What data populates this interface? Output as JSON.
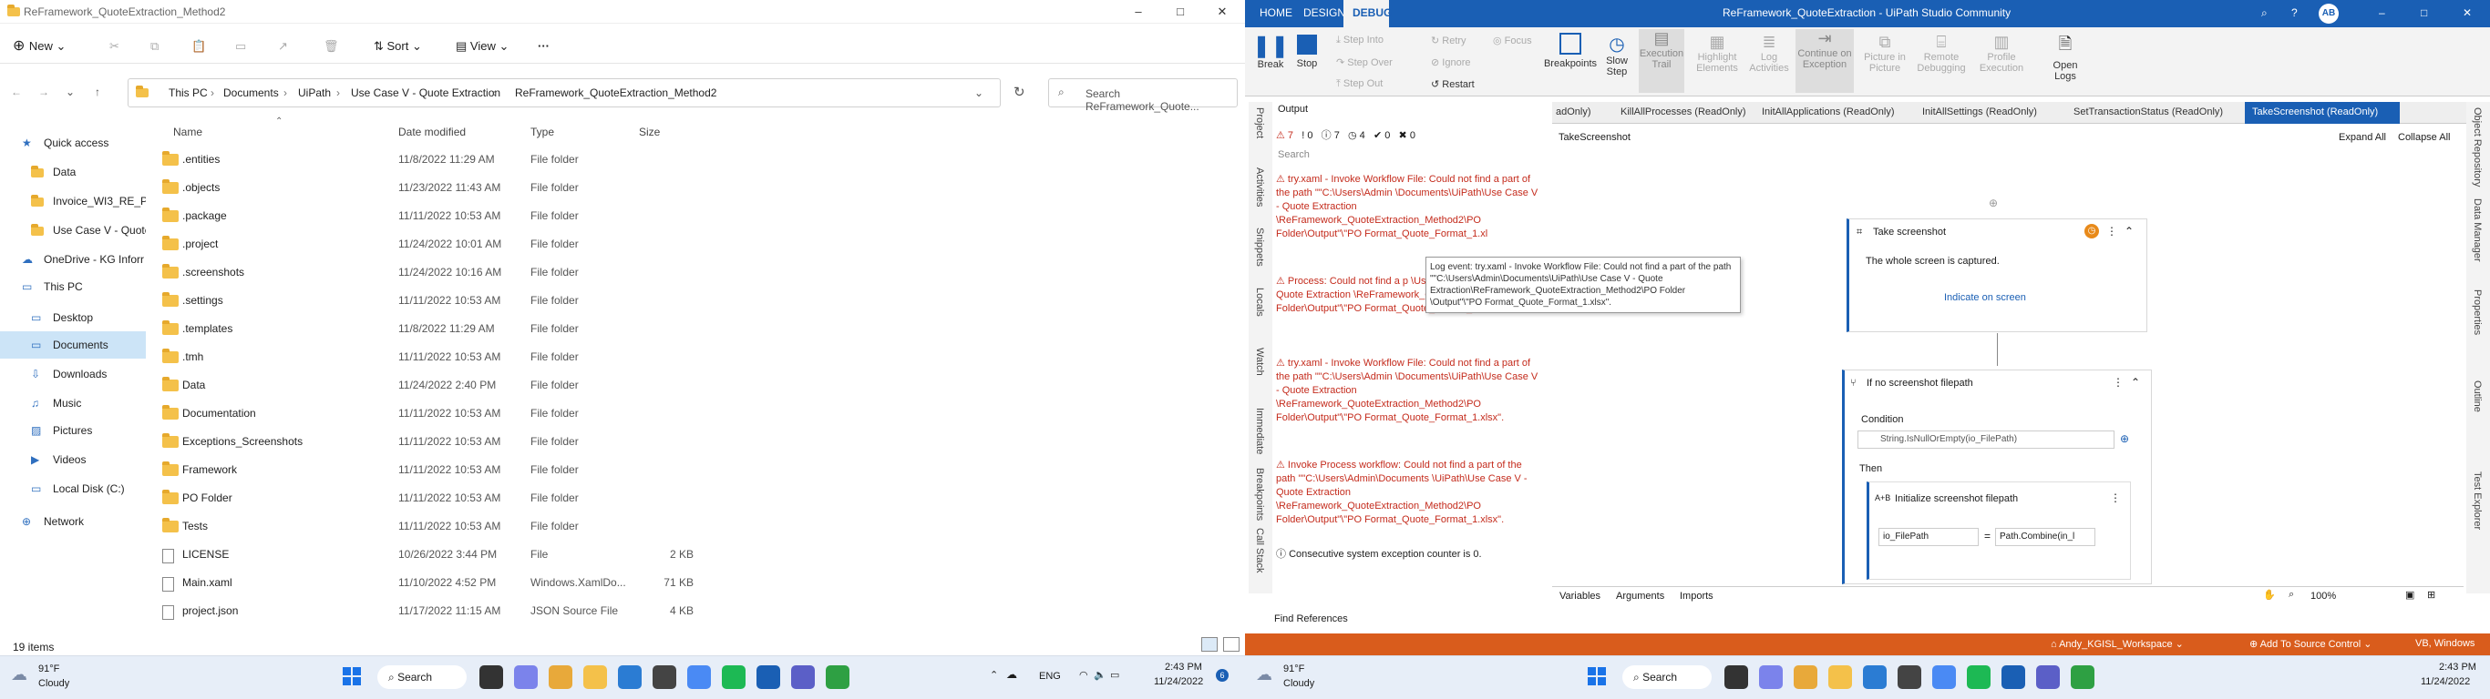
{
  "explorer": {
    "title": "ReFramework_QuoteExtraction_Method2",
    "cmd": {
      "new": "New",
      "sort": "Sort",
      "view": "View",
      "more": "···"
    },
    "breadcrumb": [
      "This PC",
      "Documents",
      "UiPath",
      "Use Case V - Quote Extraction",
      "ReFramework_QuoteExtraction_Method2"
    ],
    "search_placeholder": "Search ReFramework_Quote...",
    "nav": [
      "Quick access",
      "Data",
      "Invoice_WI3_RE_Pe",
      "Use Case V - Quote",
      "OneDrive - KG Inforr",
      "This PC",
      "Desktop",
      "Documents",
      "Downloads",
      "Music",
      "Pictures",
      "Videos",
      "Local Disk (C:)",
      "Network"
    ],
    "columns": {
      "name": "Name",
      "date": "Date modified",
      "type": "Type",
      "size": "Size"
    },
    "rows": [
      {
        "name": ".entities",
        "date": "11/8/2022 11:29 AM",
        "type": "File folder",
        "size": "",
        "kind": "folder"
      },
      {
        "name": ".objects",
        "date": "11/23/2022 11:43 AM",
        "type": "File folder",
        "size": "",
        "kind": "folder"
      },
      {
        "name": ".package",
        "date": "11/11/2022 10:53 AM",
        "type": "File folder",
        "size": "",
        "kind": "folder"
      },
      {
        "name": ".project",
        "date": "11/24/2022 10:01 AM",
        "type": "File folder",
        "size": "",
        "kind": "folder"
      },
      {
        "name": ".screenshots",
        "date": "11/24/2022 10:16 AM",
        "type": "File folder",
        "size": "",
        "kind": "folder"
      },
      {
        "name": ".settings",
        "date": "11/11/2022 10:53 AM",
        "type": "File folder",
        "size": "",
        "kind": "folder"
      },
      {
        "name": ".templates",
        "date": "11/8/2022 11:29 AM",
        "type": "File folder",
        "size": "",
        "kind": "folder"
      },
      {
        "name": ".tmh",
        "date": "11/11/2022 10:53 AM",
        "type": "File folder",
        "size": "",
        "kind": "folder"
      },
      {
        "name": "Data",
        "date": "11/24/2022 2:40 PM",
        "type": "File folder",
        "size": "",
        "kind": "folder"
      },
      {
        "name": "Documentation",
        "date": "11/11/2022 10:53 AM",
        "type": "File folder",
        "size": "",
        "kind": "folder"
      },
      {
        "name": "Exceptions_Screenshots",
        "date": "11/11/2022 10:53 AM",
        "type": "File folder",
        "size": "",
        "kind": "folder"
      },
      {
        "name": "Framework",
        "date": "11/11/2022 10:53 AM",
        "type": "File folder",
        "size": "",
        "kind": "folder"
      },
      {
        "name": "PO Folder",
        "date": "11/11/2022 10:53 AM",
        "type": "File folder",
        "size": "",
        "kind": "folder"
      },
      {
        "name": "Tests",
        "date": "11/11/2022 10:53 AM",
        "type": "File folder",
        "size": "",
        "kind": "folder"
      },
      {
        "name": "LICENSE",
        "date": "10/26/2022 3:44 PM",
        "type": "File",
        "size": "2 KB",
        "kind": "file"
      },
      {
        "name": "Main.xaml",
        "date": "11/10/2022 4:52 PM",
        "type": "Windows.XamlDo...",
        "size": "71 KB",
        "kind": "file"
      },
      {
        "name": "project.json",
        "date": "11/17/2022 11:15 AM",
        "type": "JSON Source File",
        "size": "4 KB",
        "kind": "file"
      }
    ],
    "status": "19 items"
  },
  "taskbar": {
    "weather_temp": "91°F",
    "weather_desc": "Cloudy",
    "search": "Search",
    "lang": "ENG",
    "time": "2:43 PM",
    "date": "11/24/2022"
  },
  "uipath": {
    "tabs_top": [
      "HOME",
      "DESIGN",
      "DEBUG"
    ],
    "title": "ReFramework_QuoteExtraction - UiPath Studio Community",
    "avatar": "AB",
    "ribbon": [
      "Break",
      "Stop",
      "Step Into",
      "Step Over",
      "Step Out",
      "Retry",
      "Ignore",
      "Restart",
      "Focus",
      "Breakpoints",
      "Slow Step",
      "Execution Trail",
      "Highlight Elements",
      "Log Activities",
      "Continue on Exception",
      "Picture in Picture",
      "Remote Debugging",
      "Profile Execution",
      "Open Logs"
    ],
    "output_title": "Output",
    "counts": [
      "7",
      "0",
      "7",
      "4",
      "0",
      "0"
    ],
    "search": "Search",
    "errors": [
      "try.xaml - Invoke Workflow File: Could not find a part of the path \"\"C:\\Users\\Admin \\Documents\\UiPath\\Use Case V - Quote Extraction \\ReFramework_QuoteExtraction_Method2\\PO Folder\\Output\"\\\"PO Format_Quote_Format_1.xl",
      "Process: Could not find a p \\Users\\Admin\\Documents Quote Extraction \\ReFramework_QuoteExtra Folder\\Output\"\\\"PO Format_Quote_Format_1.xlsx\".",
      "try.xaml - Invoke Workflow File: Could not find a part of the path \"\"C:\\Users\\Admin \\Documents\\UiPath\\Use Case V - Quote Extraction \\ReFramework_QuoteExtraction_Method2\\PO Folder\\Output\"\\\"PO Format_Quote_Format_1.xlsx\".",
      "Invoke Process workflow: Could not find a part of the path \"\"C:\\Users\\Admin\\Documents \\UiPath\\Use Case V - Quote Extraction \\ReFramework_QuoteExtraction_Method2\\PO Folder\\Output\"\\\"PO Format_Quote_Format_1.xlsx\"."
    ],
    "info": "Consecutive system exception counter is 0.",
    "tooltip": "Log event: try.xaml - Invoke Workflow File: Could not find a part of the path \"\"C:\\Users\\Admin\\Documents\\UiPath\\Use Case V - Quote Extraction\\ReFramework_QuoteExtraction_Method2\\PO Folder \\Output\"\\\"PO Format_Quote_Format_1.xlsx\".",
    "doc_tabs": [
      "adOnly)",
      "KillAllProcesses (ReadOnly)",
      "InitAllApplications (ReadOnly)",
      "InitAllSettings (ReadOnly)",
      "SetTransactionStatus (ReadOnly)",
      "TakeScreenshot (ReadOnly)"
    ],
    "breadcrumb": "TakeScreenshot",
    "expand": "Expand All",
    "collapse": "Collapse All",
    "act1_title": "Take screenshot",
    "act1_desc": "The whole screen is captured.",
    "act1_link": "Indicate on screen",
    "act2_title": "If no screenshot filepath",
    "condition_label": "Condition",
    "condition": "String.IsNullOrEmpty(io_FilePath)",
    "then": "Then",
    "assign_title": "Initialize screenshot filepath",
    "assign_to": "io_FilePath",
    "assign_val": "Path.Combine(in_l",
    "bottom_tabs": [
      "Variables",
      "Arguments",
      "Imports"
    ],
    "zoom": "100%",
    "find_refs": "Find References",
    "left_side": [
      "Project",
      "Activities",
      "Snippets",
      "Locals",
      "Watch",
      "Immediate",
      "Breakpoints",
      "Call Stack"
    ],
    "right_side": [
      "Object Repository",
      "Data Manager",
      "Properties",
      "Outline",
      "Test Explorer"
    ],
    "status_ws": "Andy_KGISL_Workspace",
    "status_src": "Add To Source Control",
    "status_lang": "VB, Windows"
  }
}
